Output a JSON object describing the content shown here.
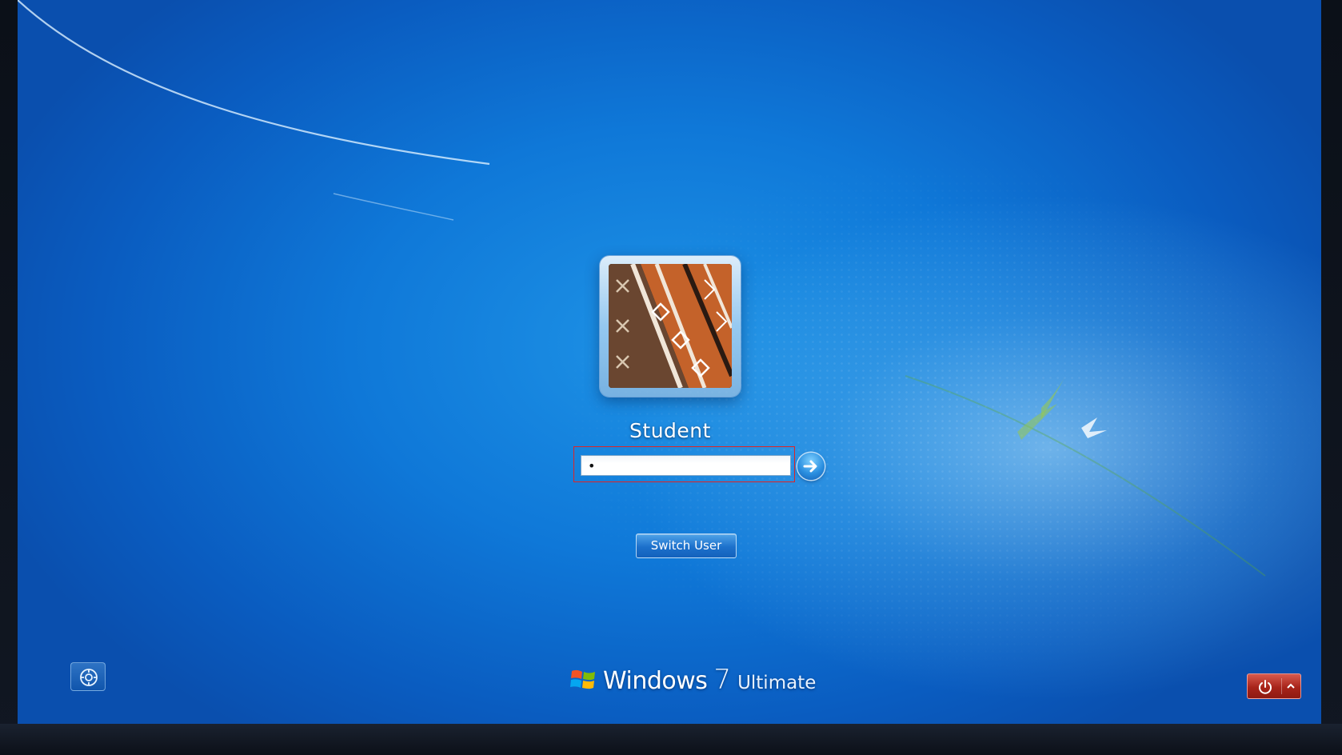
{
  "login": {
    "user_name": "Student",
    "password_value": "•",
    "password_placeholder": "",
    "switch_user_label": "Switch User"
  },
  "branding": {
    "windows": "Windows",
    "version": "7",
    "edition": "Ultimate"
  },
  "icons": {
    "submit": "arrow-right-icon",
    "ease_of_access": "ease-of-access-icon",
    "shutdown": "power-icon",
    "shutdown_options": "chevron-up-icon",
    "logo": "windows-flag-icon"
  },
  "colors": {
    "background": "#0f78d8",
    "highlight_border": "#e02424",
    "shutdown": "#a8241a"
  }
}
